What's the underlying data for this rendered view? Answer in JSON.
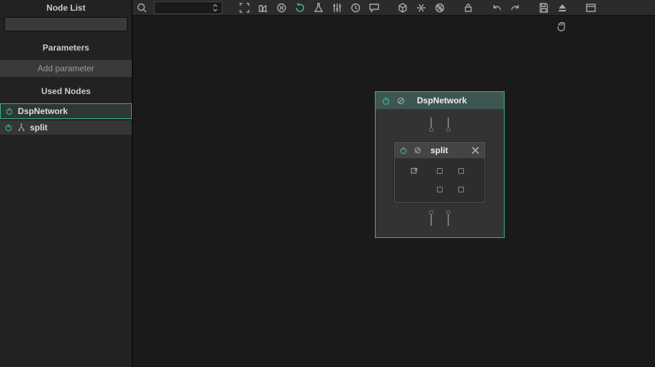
{
  "sidebar": {
    "title": "Node List",
    "search_value": "",
    "sections": {
      "parameters": "Parameters",
      "add_parameter": "Add parameter",
      "used_nodes": "Used Nodes"
    },
    "nodes": [
      {
        "label": "DspNetwork",
        "selected": true,
        "icon": "power"
      },
      {
        "label": "split",
        "selected": false,
        "icon": "route"
      }
    ]
  },
  "toolbar": {
    "select_value": "",
    "icons": [
      "search-icon",
      "select-dropdown",
      "fit-icon",
      "align-icon",
      "clear-icon",
      "refresh-icon",
      "flask-icon",
      "sliders-icon",
      "clock-icon",
      "comment-icon",
      "cube-icon",
      "recycle-icon",
      "percent-icon",
      "lock-icon",
      "undo-icon",
      "redo-icon",
      "save-icon",
      "eject-icon",
      "panel-icon"
    ]
  },
  "canvas": {
    "dsp": {
      "title": "DspNetwork",
      "split": {
        "title": "split"
      }
    }
  }
}
